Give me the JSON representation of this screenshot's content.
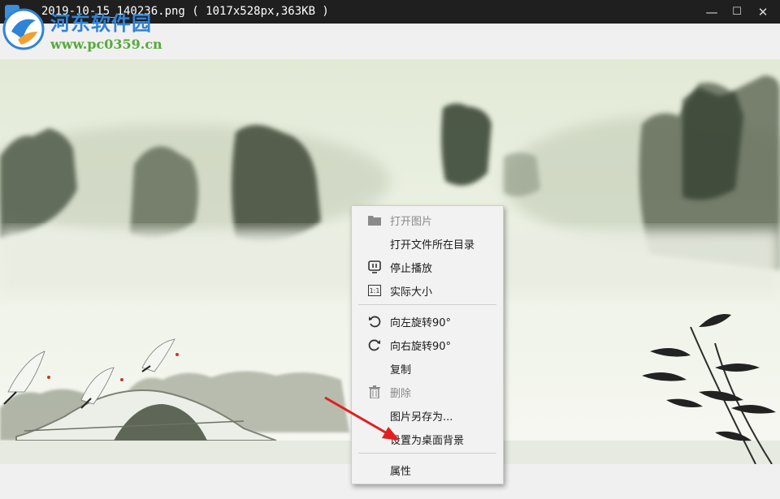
{
  "window": {
    "title": "- 2019-10-15_140236.png ( 1017x528px,363KB )",
    "controls": {
      "minimize": "—",
      "maximize": "☐",
      "close": "✕"
    }
  },
  "watermark": {
    "name": "河东软件园",
    "url": "www.pc0359.cn"
  },
  "context_menu": {
    "items": [
      {
        "label": "打开图片",
        "icon": "folder-icon",
        "disabled": true
      },
      {
        "label": "打开文件所在目录",
        "icon": "",
        "disabled": false
      },
      {
        "label": "停止播放",
        "icon": "slideshow-icon",
        "disabled": false
      },
      {
        "label": "实际大小",
        "icon": "actual-size-icon",
        "disabled": false
      },
      {
        "label": "向左旋转90°",
        "icon": "rotate-left-icon",
        "disabled": false
      },
      {
        "label": "向右旋转90°",
        "icon": "rotate-right-icon",
        "disabled": false
      },
      {
        "label": "复制",
        "icon": "",
        "disabled": false
      },
      {
        "label": "删除",
        "icon": "trash-icon",
        "disabled": true
      },
      {
        "label": "图片另存为...",
        "icon": "",
        "disabled": false
      },
      {
        "label": "设置为桌面背景",
        "icon": "",
        "disabled": false
      },
      {
        "label": "属性",
        "icon": "",
        "disabled": false
      }
    ],
    "icon_text": {
      "actual_size": "1:1"
    }
  },
  "colors": {
    "titlebar": "#1f1f1f",
    "accent_arrow": "#e02020",
    "watermark_blue": "#2f84d8",
    "watermark_green": "#56a93a"
  }
}
